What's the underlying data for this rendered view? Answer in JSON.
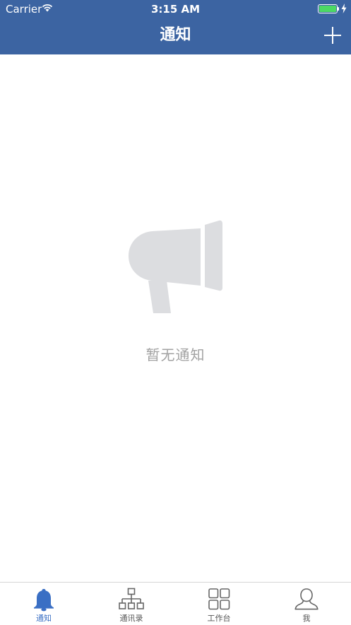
{
  "status_bar": {
    "carrier": "Carrier",
    "time": "3:15 AM",
    "wifi_icon": "wifi-icon",
    "battery_icon": "battery-full-icon",
    "battery_color": "#4cd964"
  },
  "nav": {
    "title": "通知",
    "add_icon": "plus-icon",
    "background": "#3c64a2"
  },
  "empty_state": {
    "icon": "megaphone-icon",
    "message": "暂无通知"
  },
  "tabs": [
    {
      "label": "通知",
      "icon": "bell-icon",
      "active": true
    },
    {
      "label": "通讯录",
      "icon": "org-chart-icon",
      "active": false
    },
    {
      "label": "工作台",
      "icon": "grid-icon",
      "active": false
    },
    {
      "label": "我",
      "icon": "user-icon",
      "active": false
    }
  ],
  "colors": {
    "accent": "#3a6fc4",
    "inactive": "#555555",
    "empty_text": "#a2a2a2",
    "icon_gray": "#dcdde0"
  }
}
